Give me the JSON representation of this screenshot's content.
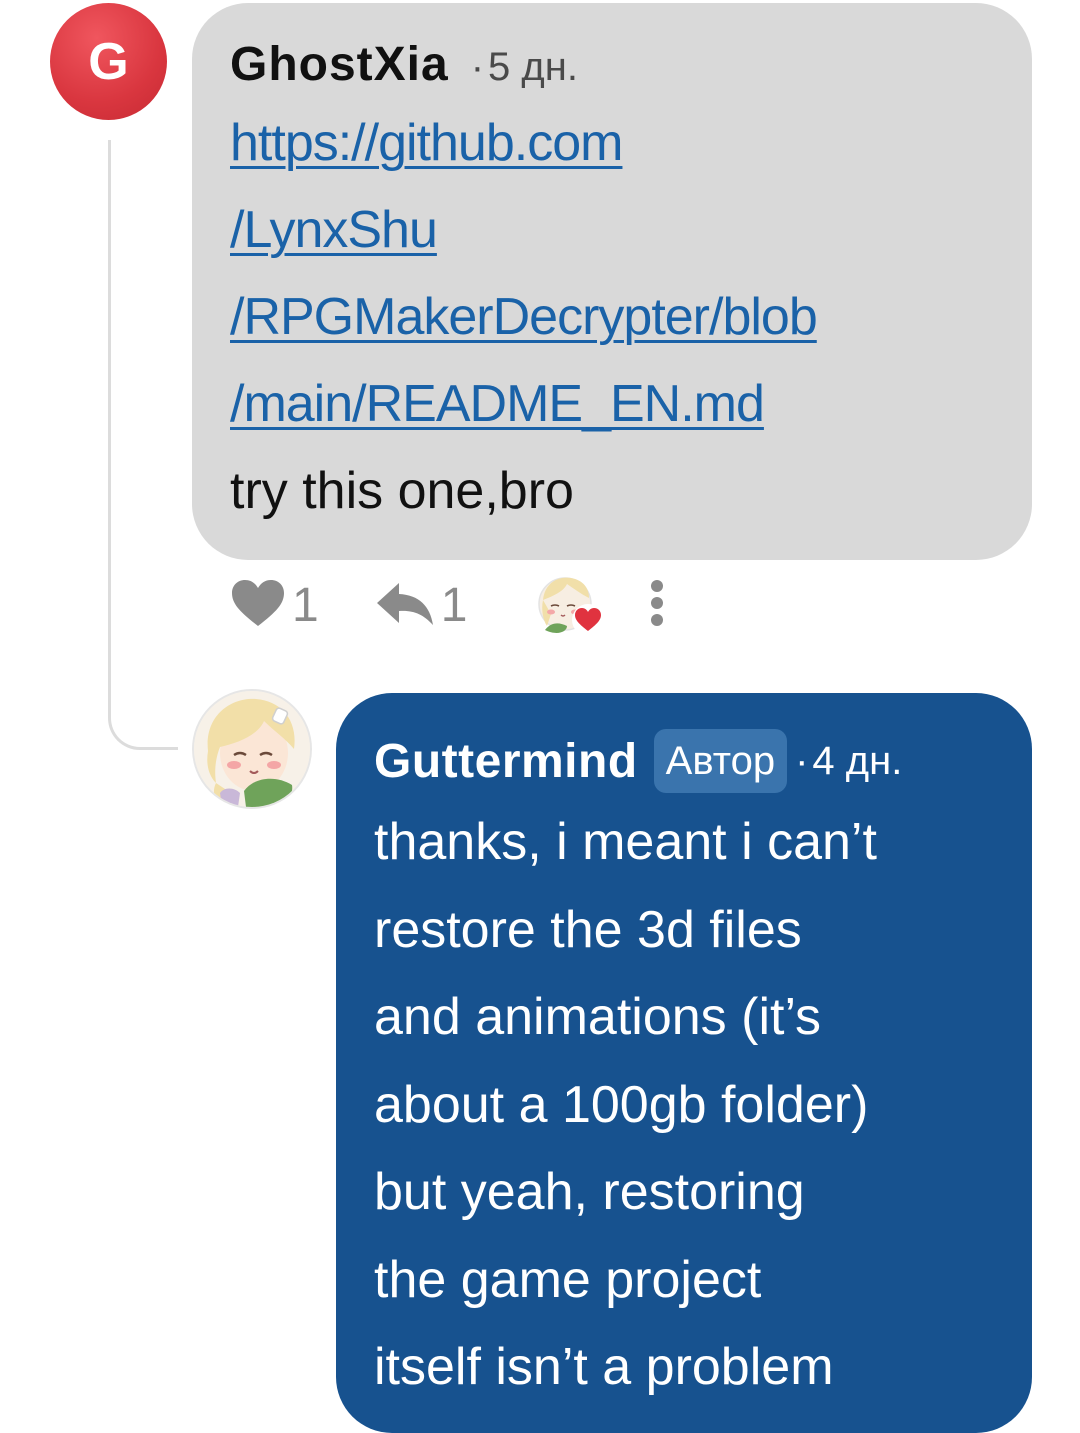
{
  "comment_1": {
    "avatar_letter": "G",
    "username": "GhostXia",
    "separator": "·",
    "time": "5 дн.",
    "link_lines": [
      "https://github.com",
      "/LynxShu",
      "/RPGMakerDecrypter/blob",
      "/main/README_EN.md"
    ],
    "body": "try this one,bro",
    "actions": {
      "like_count": "1",
      "reply_count": "1"
    }
  },
  "comment_2": {
    "username": "Guttermind",
    "badge": "Автор",
    "separator": "·",
    "time": "4 дн.",
    "body_lines": [
      "thanks, i meant i can’t",
      "restore the 3d files",
      "and animations (it’s",
      "about a 100gb folder)",
      "but yeah, restoring",
      "the game project",
      "itself isn’t a problem"
    ]
  },
  "icons": {
    "like": "heart-icon",
    "reply": "reply-arrow-icon",
    "more": "vertical-dots-icon",
    "reaction": "heart-reaction-icon"
  },
  "colors": {
    "bubble_gray": "#d9d9d9",
    "bubble_blue": "#17528f",
    "link": "#1a62a8",
    "avatar_red": "#d9363f",
    "reaction_red": "#e0333f"
  }
}
